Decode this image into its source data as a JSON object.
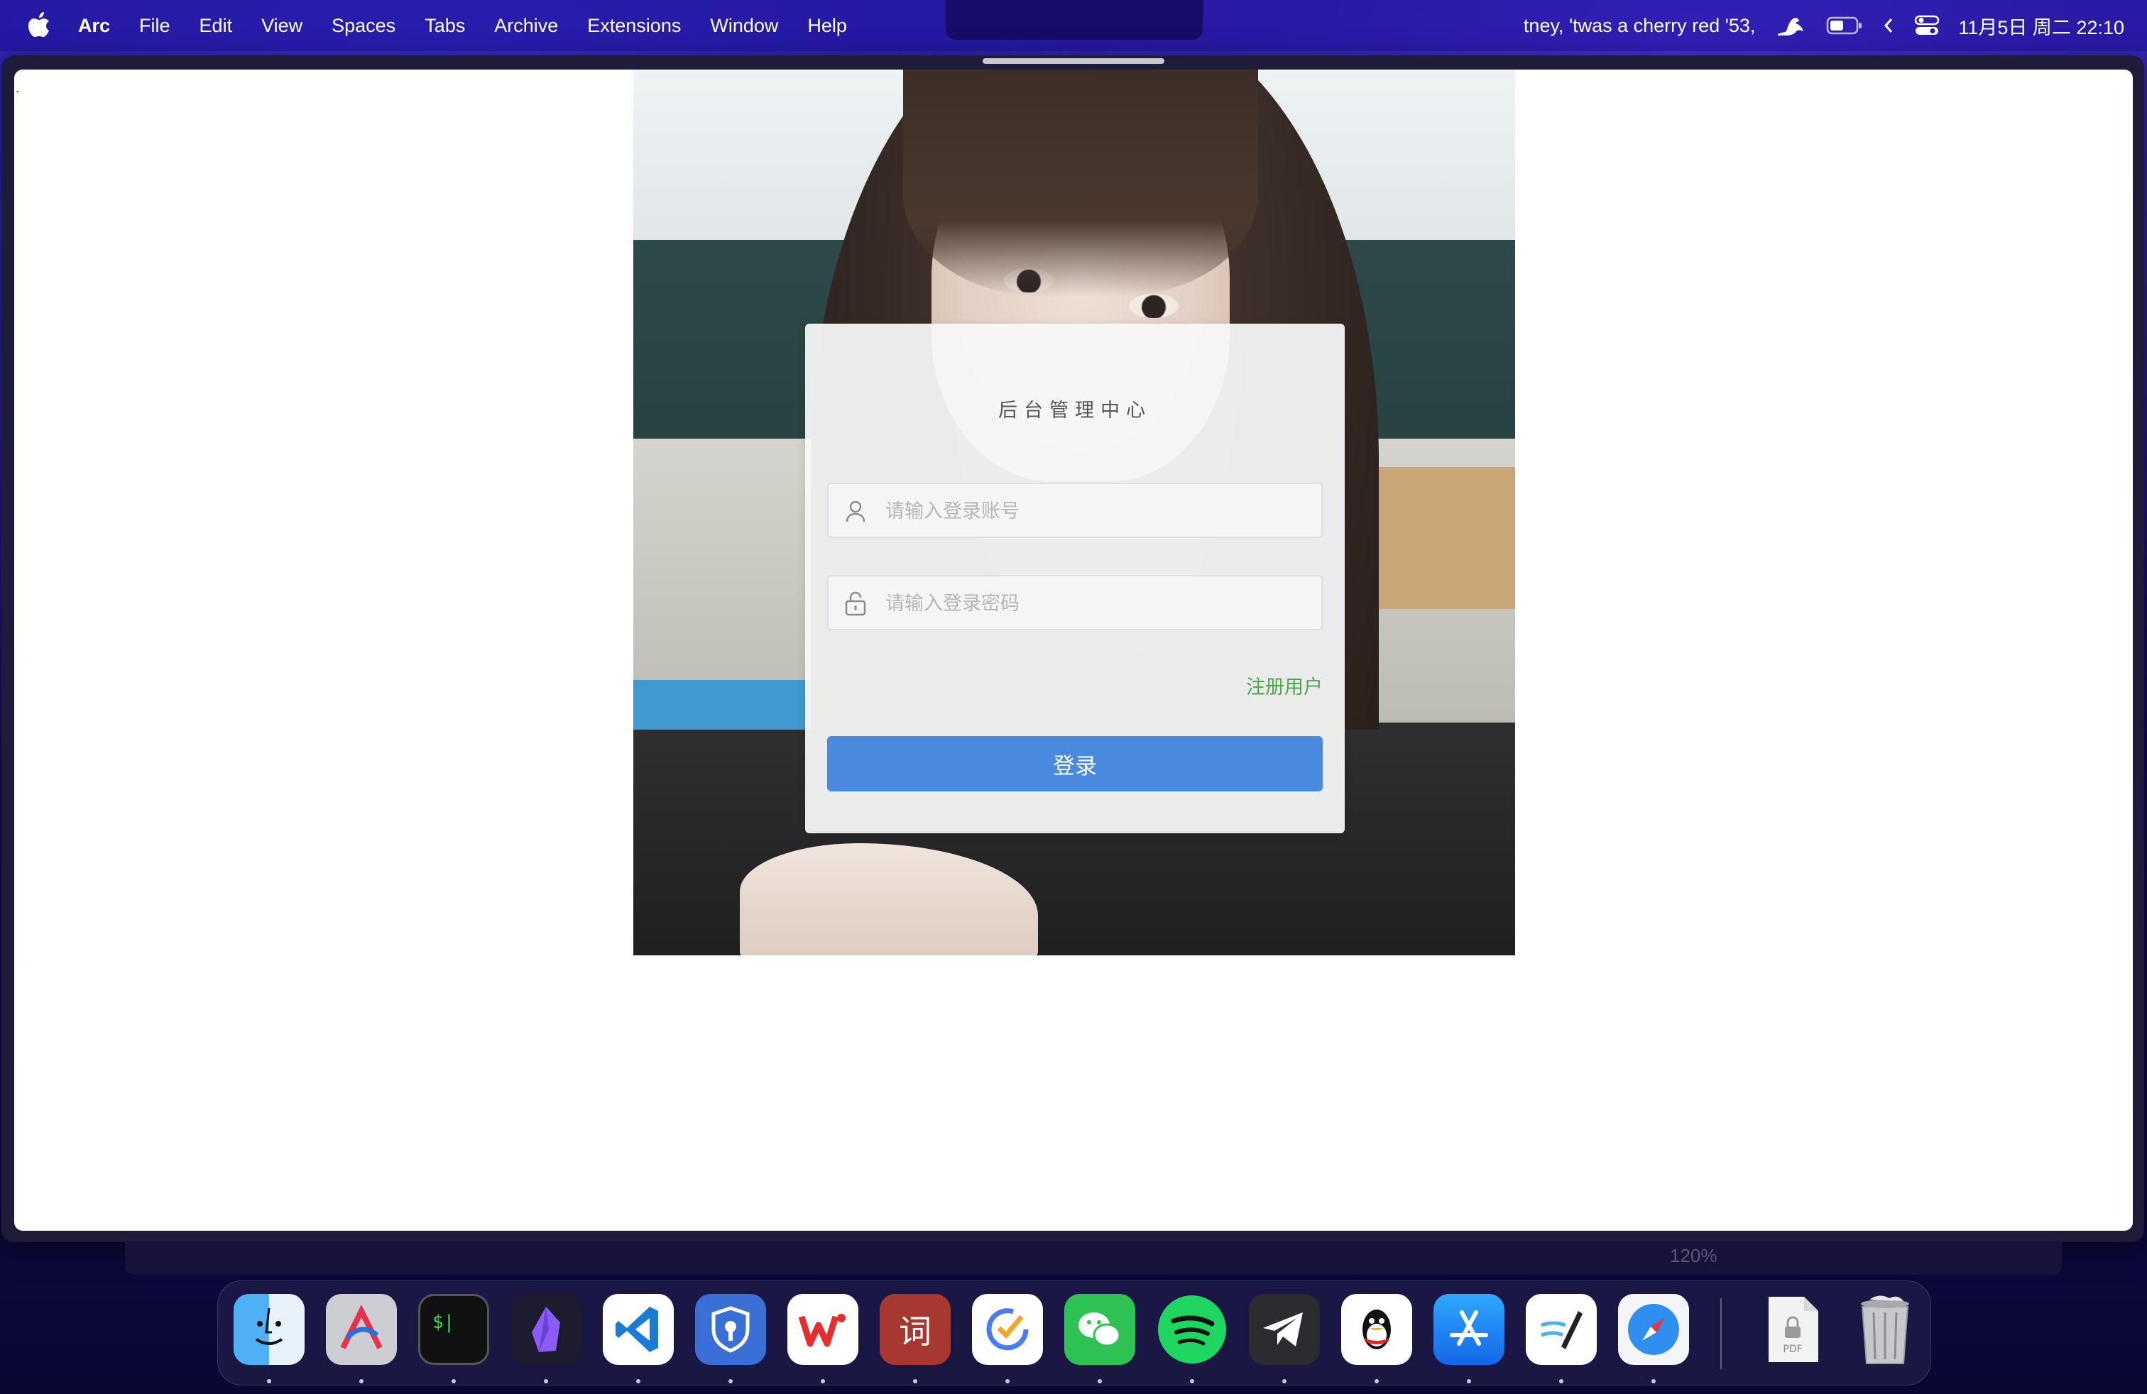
{
  "menubar": {
    "app_name": "Arc",
    "items": [
      "File",
      "Edit",
      "View",
      "Spaces",
      "Tabs",
      "Archive",
      "Extensions",
      "Window",
      "Help"
    ],
    "now_playing": "tney, 'twas a cherry red '53,",
    "datetime": "11月5日 周二  22:10"
  },
  "page": {
    "dot": ".",
    "login": {
      "title": "后台管理中心",
      "account_placeholder": "请输入登录账号",
      "password_placeholder": "请输入登录密码",
      "register_label": "注册用户",
      "submit_label": "登录"
    }
  },
  "window_footer": {
    "zoom": "120%"
  },
  "dock": {
    "apps": [
      {
        "name": "Finder",
        "icon": "finder-icon"
      },
      {
        "name": "Affinity",
        "icon": "affinity-icon"
      },
      {
        "name": "Terminal",
        "icon": "terminal-icon"
      },
      {
        "name": "Obsidian",
        "icon": "obsidian-icon"
      },
      {
        "name": "Visual Studio Code",
        "icon": "vscode-icon"
      },
      {
        "name": "Bitwarden",
        "icon": "bitwarden-icon"
      },
      {
        "name": "WPS Office",
        "icon": "wps-icon"
      },
      {
        "name": "Dictionary",
        "icon": "dictionary-icon",
        "glyph": "词"
      },
      {
        "name": "TickTick",
        "icon": "ticktick-icon"
      },
      {
        "name": "WeChat",
        "icon": "wechat-icon"
      },
      {
        "name": "Spotify",
        "icon": "spotify-icon"
      },
      {
        "name": "Telegram",
        "icon": "telegram-icon"
      },
      {
        "name": "QQ",
        "icon": "qq-icon"
      },
      {
        "name": "App Store",
        "icon": "appstore-icon"
      },
      {
        "name": "Freeform",
        "icon": "freeform-icon"
      },
      {
        "name": "Safari",
        "icon": "safari-icon"
      },
      {
        "name": "PDF Document",
        "icon": "pdf-file-icon",
        "label": "PDF"
      },
      {
        "name": "Trash",
        "icon": "trash-icon"
      }
    ]
  },
  "colors": {
    "login_button": "#4a89e0",
    "register_link": "#4aa84a"
  }
}
